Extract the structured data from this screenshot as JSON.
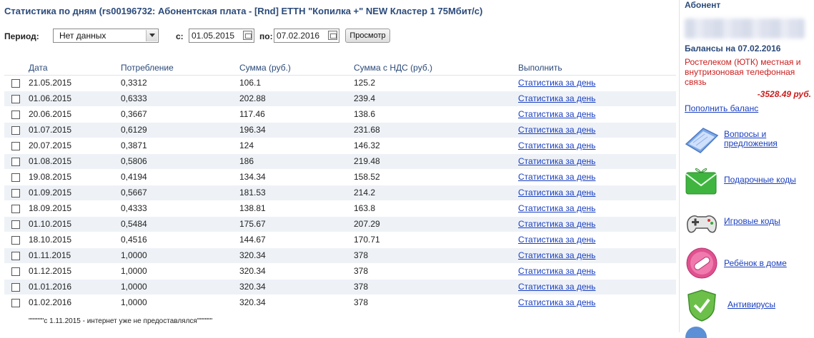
{
  "page_title": "Статистика по дням (rs00196732: Абонентская плата - [Rnd] ETTH \"Копилка +\" NEW Кластер 1 75Мбит/с)",
  "filter": {
    "period_label": "Период:",
    "period_value": "Нет данных",
    "from_label": "с:",
    "from_value": "01.05.2015",
    "to_label": "по:",
    "to_value": "07.02.2016",
    "view_button": "Просмотр"
  },
  "table": {
    "headers": [
      "Дата",
      "Потребление",
      "Сумма (руб.)",
      "Сумма с НДС (руб.)",
      "Выполнить"
    ],
    "rows": [
      {
        "date": "21.05.2015",
        "usage": "0,3312",
        "sum": "106.1",
        "sum_vat": "125.2",
        "action": "Статистика за день"
      },
      {
        "date": "01.06.2015",
        "usage": "0,6333",
        "sum": "202.88",
        "sum_vat": "239.4",
        "action": "Статистика за день"
      },
      {
        "date": "20.06.2015",
        "usage": "0,3667",
        "sum": "117.46",
        "sum_vat": "138.6",
        "action": "Статистика за день"
      },
      {
        "date": "01.07.2015",
        "usage": "0,6129",
        "sum": "196.34",
        "sum_vat": "231.68",
        "action": "Статистика за день"
      },
      {
        "date": "20.07.2015",
        "usage": "0,3871",
        "sum": "124",
        "sum_vat": "146.32",
        "action": "Статистика за день"
      },
      {
        "date": "01.08.2015",
        "usage": "0,5806",
        "sum": "186",
        "sum_vat": "219.48",
        "action": "Статистика за день"
      },
      {
        "date": "19.08.2015",
        "usage": "0,4194",
        "sum": "134.34",
        "sum_vat": "158.52",
        "action": "Статистика за день"
      },
      {
        "date": "01.09.2015",
        "usage": "0,5667",
        "sum": "181.53",
        "sum_vat": "214.2",
        "action": "Статистика за день"
      },
      {
        "date": "18.09.2015",
        "usage": "0,4333",
        "sum": "138.81",
        "sum_vat": "163.8",
        "action": "Статистика за день"
      },
      {
        "date": "01.10.2015",
        "usage": "0,5484",
        "sum": "175.67",
        "sum_vat": "207.29",
        "action": "Статистика за день"
      },
      {
        "date": "18.10.2015",
        "usage": "0,4516",
        "sum": "144.67",
        "sum_vat": "170.71",
        "action": "Статистика за день"
      },
      {
        "date": "01.11.2015",
        "usage": "1,0000",
        "sum": "320.34",
        "sum_vat": "378",
        "action": "Статистика за день"
      },
      {
        "date": "01.12.2015",
        "usage": "1,0000",
        "sum": "320.34",
        "sum_vat": "378",
        "action": "Статистика за день"
      },
      {
        "date": "01.01.2016",
        "usage": "1,0000",
        "sum": "320.34",
        "sum_vat": "378",
        "action": "Статистика за день"
      },
      {
        "date": "01.02.2016",
        "usage": "1,0000",
        "sum": "320.34",
        "sum_vat": "378",
        "action": "Статистика за день"
      }
    ]
  },
  "note": "\"\"\"\"\"\"с 1.11.2015 - интернет уже не предоставлялся\"\"\"\"\"\"",
  "sidebar": {
    "subscriber_heading": "Абонент",
    "balance_title": "Балансы на 07.02.2016",
    "balance_desc": "Ростелеком (ЮТК) местная и внутризоновая телефонная связь",
    "balance_amount": "-3528.49 руб.",
    "topup_link": "Пополнить баланс",
    "menu": [
      {
        "label": "Вопросы и предложения",
        "icon": "questions-icon"
      },
      {
        "label": "Подарочные коды",
        "icon": "gift-envelope-icon"
      },
      {
        "label": "Игровые коды",
        "icon": "gamepad-icon"
      },
      {
        "label": "Ребёнок в доме",
        "icon": "child-pill-icon"
      },
      {
        "label": "Антивирусы",
        "icon": "shield-icon"
      }
    ]
  },
  "colors": {
    "title": "#2b4a7a",
    "link": "#1a3fbf",
    "negative": "#cc1d1d",
    "row_alt": "#eef2f7"
  }
}
